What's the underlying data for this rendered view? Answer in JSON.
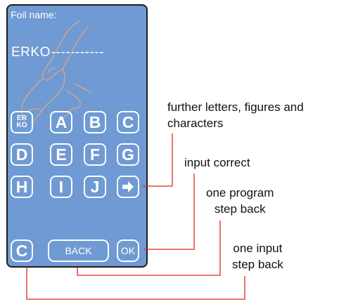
{
  "screen": {
    "label": "Foil name:",
    "value_entered": "ERKO",
    "value_rest": "-----------"
  },
  "keyboard": {
    "special_key": {
      "line1": "ER",
      "line2": "KO"
    },
    "letters_row1": [
      "A",
      "B",
      "C"
    ],
    "letters_row2": [
      "D",
      "E",
      "F",
      "G"
    ],
    "letters_row3": [
      "H",
      "I",
      "J"
    ],
    "enter_icon": "arrow-right-icon"
  },
  "bottom_bar": {
    "clear_label": "C",
    "back_label": "BACK",
    "ok_label": "OK"
  },
  "callouts": {
    "further_line1": "further letters, figures and",
    "further_line2": "characters",
    "input_correct": "input correct",
    "program_back_line1": "one program",
    "program_back_line2": "step back",
    "input_back_line1": "one input",
    "input_back_line2": "step back"
  },
  "colors": {
    "screen_bg": "#6f9ad3",
    "callout_line": "#e1251b",
    "finger_outline": "#d9a882"
  }
}
